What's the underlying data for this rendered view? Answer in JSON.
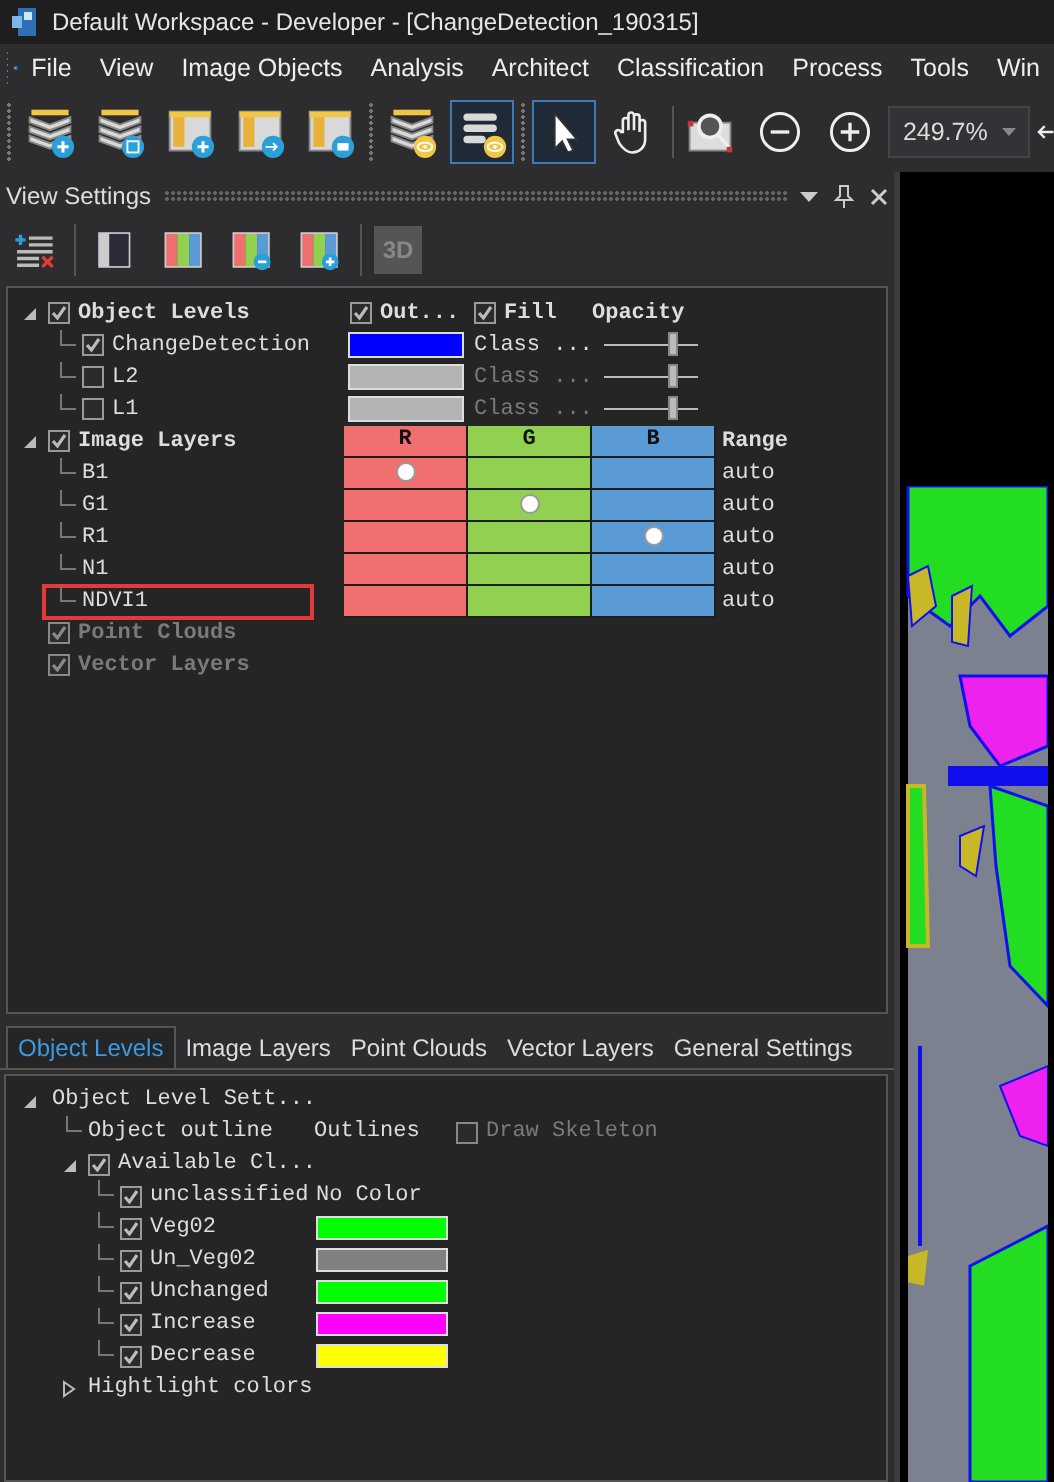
{
  "window": {
    "title": "Default Workspace - Developer - [ChangeDetection_190315]"
  },
  "menu": [
    "File",
    "View",
    "Image Objects",
    "Analysis",
    "Architect",
    "Classification",
    "Process",
    "Tools",
    "Win"
  ],
  "toolbar": [
    {
      "kind": "addlayer",
      "selected": false
    },
    {
      "kind": "savelayer",
      "selected": false
    },
    {
      "kind": "addpanel",
      "selected": false
    },
    {
      "kind": "importpanel",
      "selected": false
    },
    {
      "kind": "openpanel",
      "selected": false
    },
    {
      "kind": "showlayers",
      "selected": false
    },
    {
      "kind": "showlist",
      "selected": true
    },
    {
      "kind": "pointer",
      "selected": true
    },
    {
      "kind": "pan",
      "selected": false
    },
    {
      "kind": "zoomarea",
      "selected": false
    },
    {
      "kind": "zoomout",
      "selected": false
    },
    {
      "kind": "zoomin",
      "selected": false
    }
  ],
  "zoom": {
    "value": "249.7%"
  },
  "view_settings": {
    "title": "View Settings",
    "toolbar": [
      {
        "kind": "addremove"
      },
      {
        "kind": "single"
      },
      {
        "kind": "rgb"
      },
      {
        "kind": "rgbminus"
      },
      {
        "kind": "rgbplus"
      },
      {
        "kind": "text",
        "label": "3D",
        "disabled": true
      }
    ],
    "object_levels": {
      "label": "Object Levels",
      "checked": true,
      "expanded": true,
      "outline_header": {
        "label": "Out...",
        "checked": true
      },
      "fill_header": {
        "label": "Fill",
        "checked": true
      },
      "opacity_header": "Opacity",
      "levels": [
        {
          "name": "ChangeDetection",
          "checked": true,
          "color": "#0000ff",
          "fill": "Class ...",
          "level": 0.72
        },
        {
          "name": "L2",
          "checked": false,
          "color": "#b4b4b4",
          "fill": "Class ...",
          "level": 0.72
        },
        {
          "name": "L1",
          "checked": false,
          "color": "#b4b4b4",
          "fill": "Class ...",
          "level": 0.72
        }
      ]
    },
    "image_layers": {
      "label": "Image Layers",
      "checked": true,
      "expanded": true,
      "channels": [
        "R",
        "G",
        "B"
      ],
      "range_header": "Range",
      "layers": [
        {
          "name": "B1",
          "assigned": [
            true,
            false,
            false
          ],
          "range": "auto",
          "highlighted": false
        },
        {
          "name": "G1",
          "assigned": [
            false,
            true,
            false
          ],
          "range": "auto",
          "highlighted": false
        },
        {
          "name": "R1",
          "assigned": [
            false,
            false,
            true
          ],
          "range": "auto",
          "highlighted": false
        },
        {
          "name": "N1",
          "assigned": [
            false,
            false,
            false
          ],
          "range": "auto",
          "highlighted": false
        },
        {
          "name": "NDVI1",
          "assigned": [
            false,
            false,
            false
          ],
          "range": "auto",
          "highlighted": true
        }
      ]
    },
    "point_clouds": {
      "label": "Point Clouds",
      "checked": true,
      "disabled": true
    },
    "vector_layers": {
      "label": "Vector Layers",
      "checked": true,
      "disabled": true
    }
  },
  "tabs": [
    {
      "label": "Object Levels",
      "selected": true
    },
    {
      "label": "Image Layers",
      "selected": false
    },
    {
      "label": "Point Clouds",
      "selected": false
    },
    {
      "label": "Vector Layers",
      "selected": false
    },
    {
      "label": "General Settings",
      "selected": false
    }
  ],
  "settings": {
    "label": "Object Level Sett...",
    "expanded": true,
    "outline": {
      "label": "Object outline",
      "value": "Outlines",
      "skeleton": {
        "label": "Draw Skeleton",
        "checked": false,
        "disabled": true
      }
    },
    "classes": {
      "label": "Available Cl...",
      "checked": true,
      "expanded": true,
      "items": [
        {
          "name": "unclassified",
          "checked": true,
          "value": "No Color"
        },
        {
          "name": "Veg02",
          "checked": true,
          "color": "#00ff00"
        },
        {
          "name": "Un_Veg02",
          "checked": true,
          "color": "#808080"
        },
        {
          "name": "Unchanged",
          "checked": true,
          "color": "#00ff00"
        },
        {
          "name": "Increase",
          "checked": true,
          "color": "#ff00ff"
        },
        {
          "name": "Decrease",
          "checked": true,
          "color": "#ffff00"
        }
      ]
    },
    "highlight": {
      "label": "Hightlight colors",
      "expanded": false
    }
  }
}
